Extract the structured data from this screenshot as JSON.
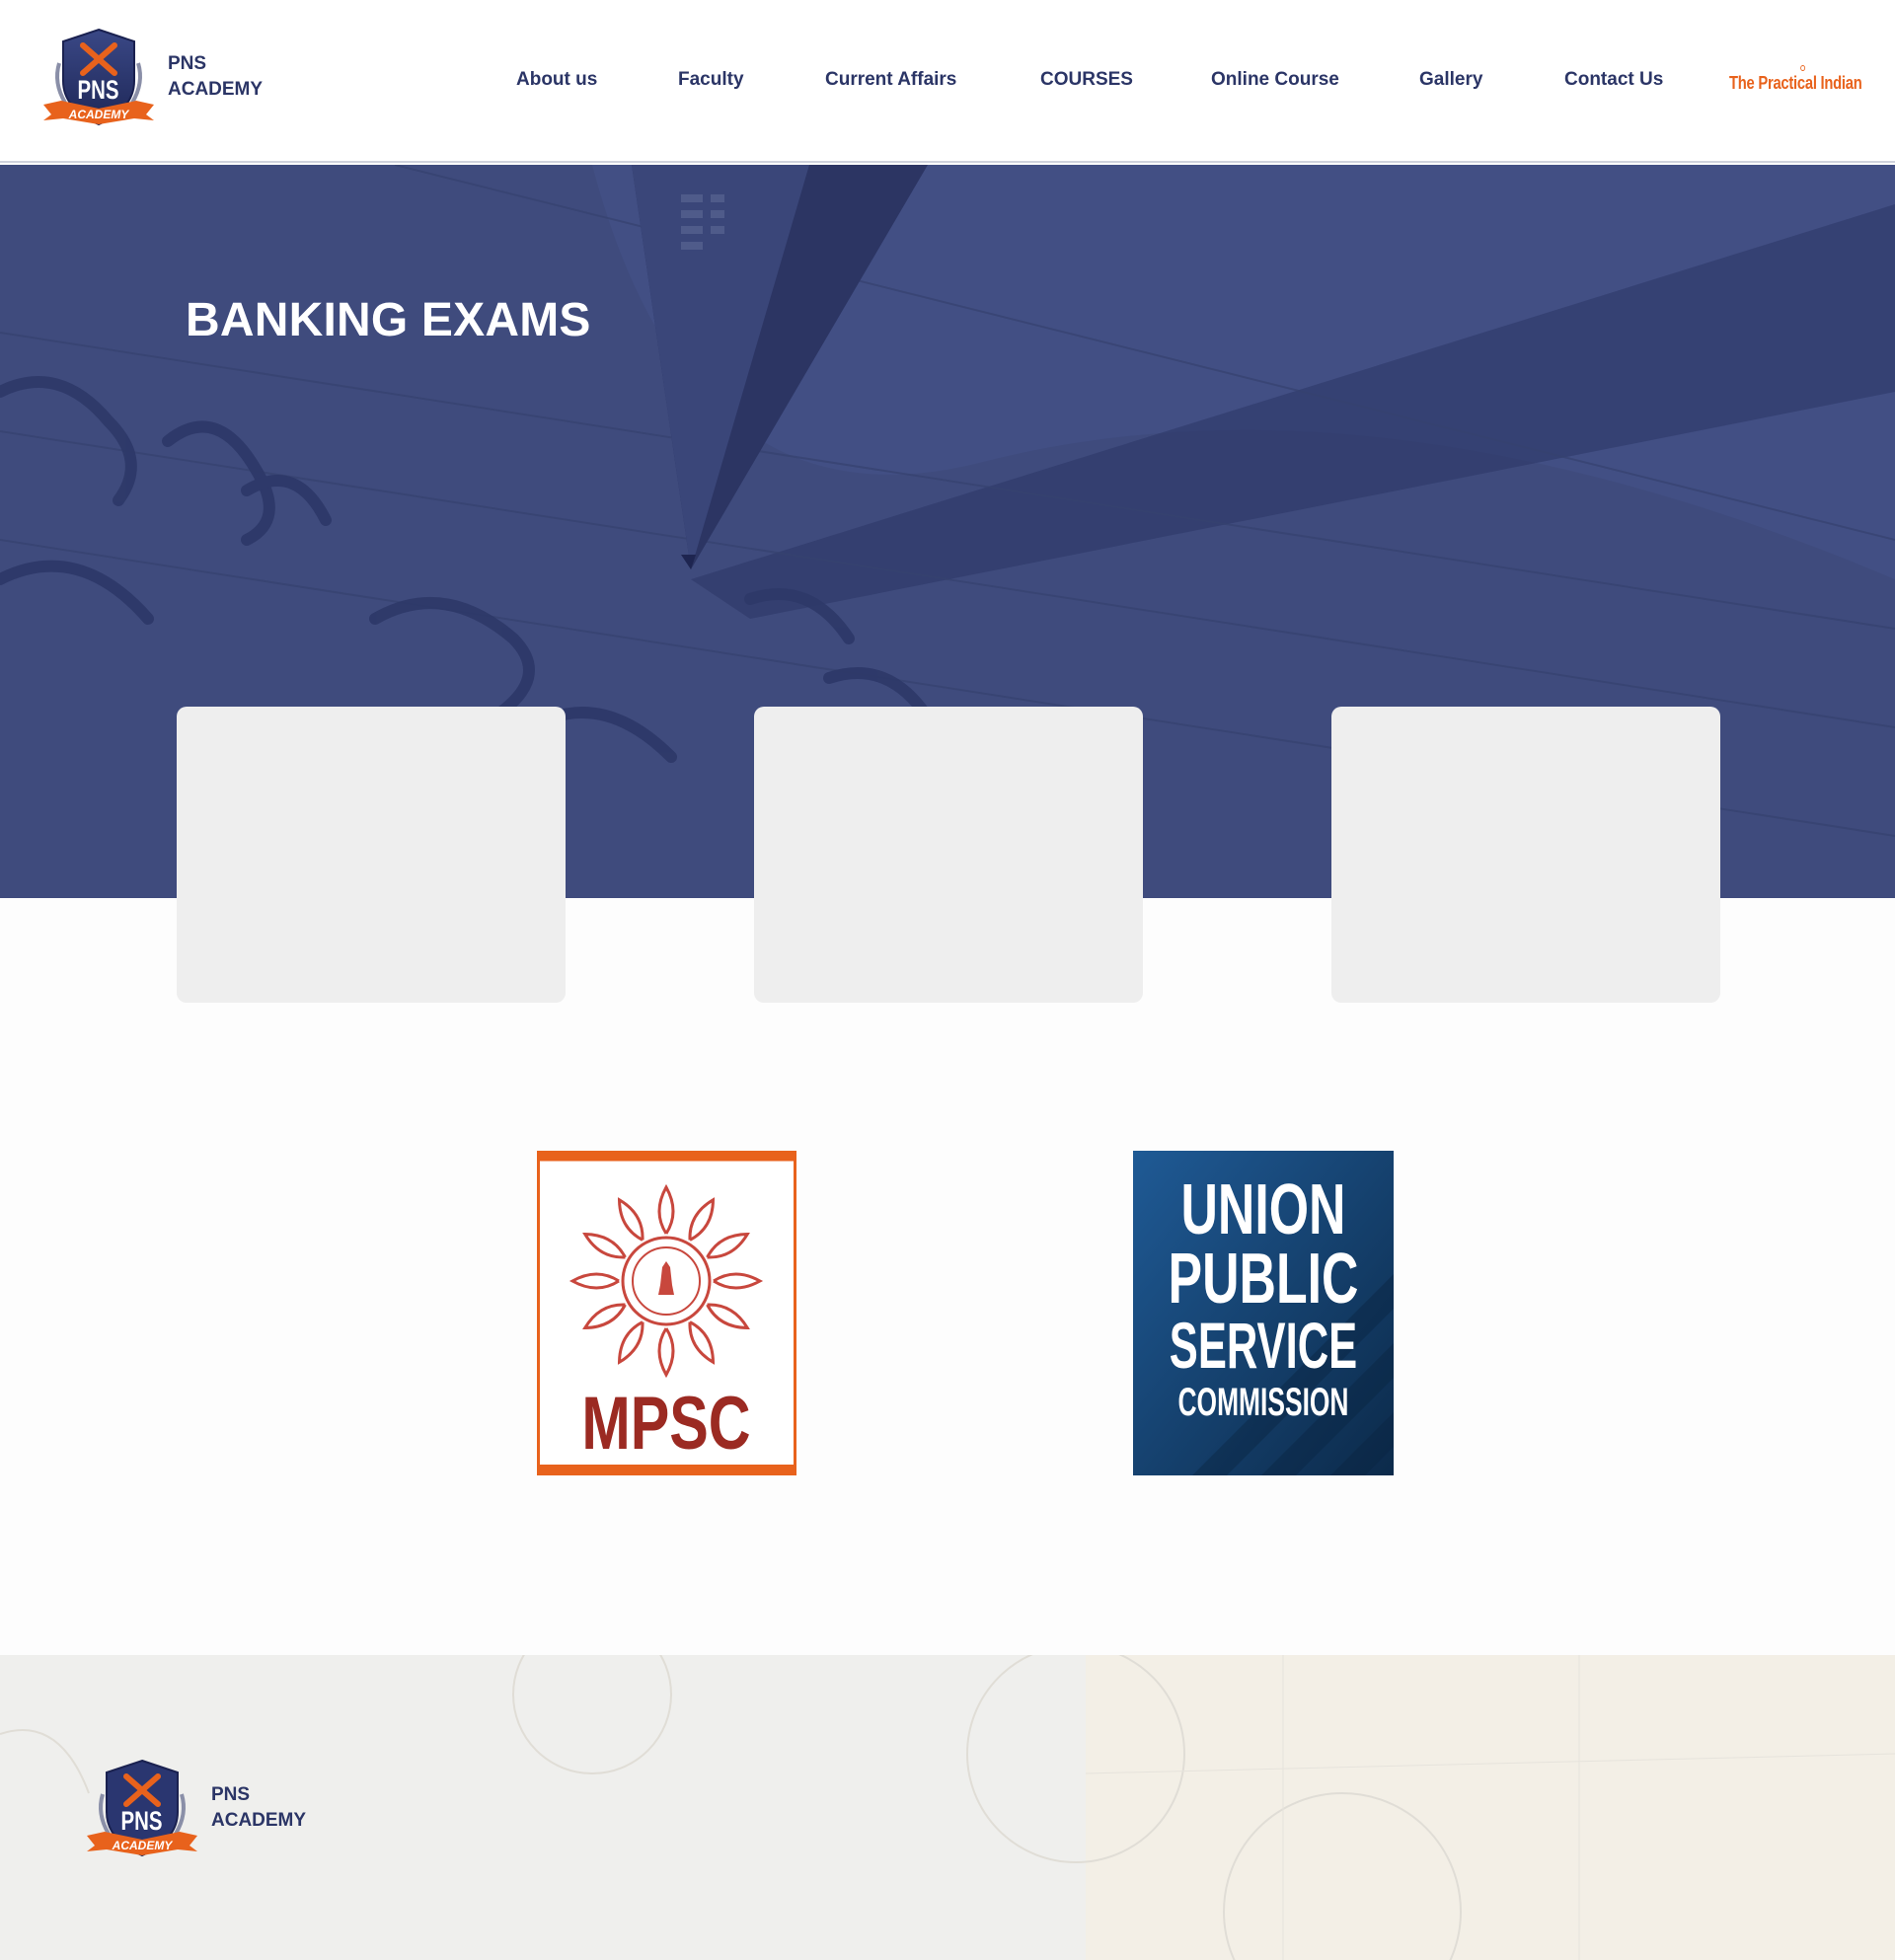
{
  "header": {
    "brand_line1": "PNS",
    "brand_line2": "ACADEMY",
    "nav": [
      "About us",
      "Faculty",
      "Current Affairs",
      "COURSES",
      "Online Course",
      "Gallery",
      "Contact Us"
    ],
    "practical_label": "The Practical Indian"
  },
  "logo": {
    "badge_text": "PNS",
    "ribbon_text": "ACADEMY"
  },
  "hero": {
    "title": "BANKING EXAMS"
  },
  "cards": [
    {
      "label": ""
    },
    {
      "label": ""
    },
    {
      "label": ""
    }
  ],
  "exam_logos": {
    "mpsc": {
      "text": "MPSC"
    },
    "upsc": {
      "line1": "UNION",
      "line2": "PUBLIC",
      "line3": "SERVICE",
      "line4": "COMMISSION"
    }
  },
  "footer": {
    "brand_line1": "PNS",
    "brand_line2": "ACADEMY"
  },
  "colors": {
    "navy": "#2b3566",
    "accent_orange": "#e8621c",
    "hero_overlay": "#3e4a7c",
    "card_bg": "#eeeeee",
    "mpsc_red": "#9b2a22",
    "upsc_blue": "#1a4f86"
  }
}
